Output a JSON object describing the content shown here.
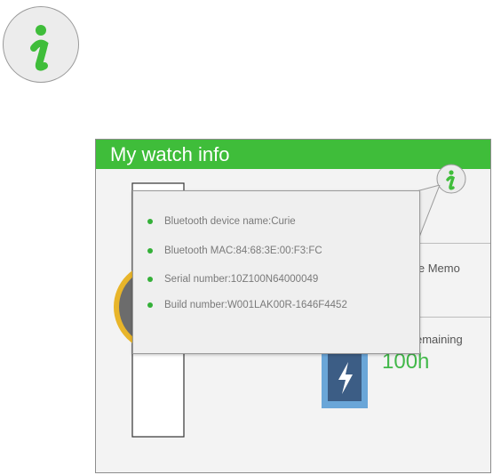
{
  "info_badge": {
    "icon": "info-icon"
  },
  "screen": {
    "title": "My watch info",
    "right_label_1": "le Memo",
    "right_label_2": "emaining",
    "battery_hours": "100h",
    "info_button_icon": "info-icon"
  },
  "popup": {
    "items": [
      {
        "label": "Bluetooth device name:Curie"
      },
      {
        "label": "Bluetooth MAC:84:68:3E:00:F3:FC"
      },
      {
        "label": "Serial number:10Z100N64000049"
      },
      {
        "label": "Build number:W001LAK00R-1646F4452"
      }
    ]
  },
  "colors": {
    "accent_green": "#3fbd3a",
    "bullet_green": "#34b038",
    "battery_blue": "#6aa6d8"
  }
}
